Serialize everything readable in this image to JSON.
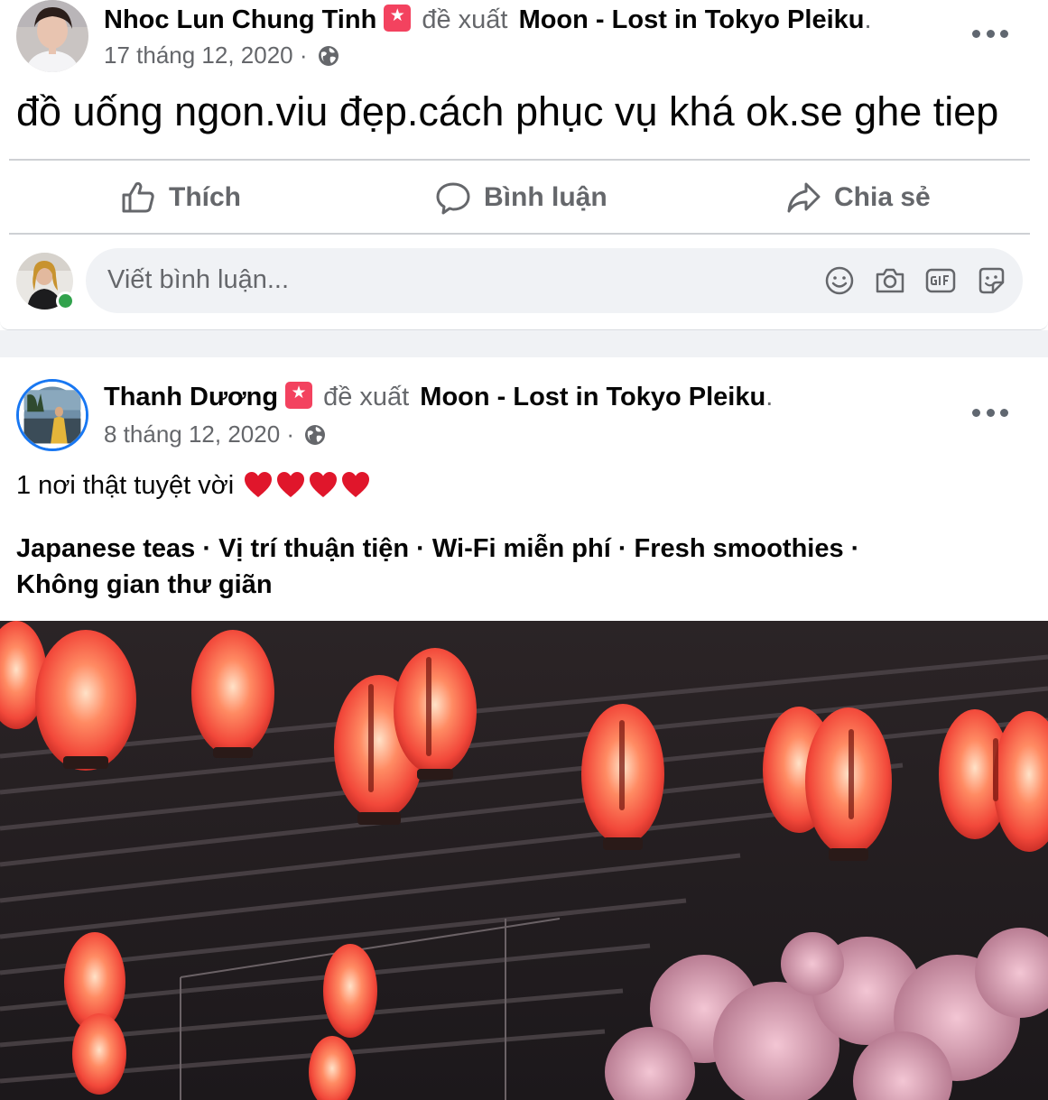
{
  "post1": {
    "author": "Nhoc Lun Chung Tinh",
    "recommends_label": "đề xuất",
    "page_name": "Moon - Lost in Tokyo Pleiku",
    "period": ".",
    "date": "17 tháng 12, 2020",
    "meta_separator": "·",
    "text": "đồ uống ngon.viu đẹp.cách phục vụ khá ok.se ghe tiep",
    "actions": {
      "like": "Thích",
      "comment": "Bình luận",
      "share": "Chia sẻ"
    },
    "comment_placeholder": "Viết bình luận..."
  },
  "post2": {
    "author": "Thanh Dương",
    "recommends_label": "đề xuất",
    "page_name": "Moon - Lost in Tokyo Pleiku",
    "period": ".",
    "date": "8 tháng 12, 2020",
    "meta_separator": "·",
    "text": "1 nơi thật tuyệt vời",
    "heart_count": 4,
    "tags_line1": "Japanese teas · Vị trí thuận tiện · Wi-Fi miễn phí · Fresh smoothies ·",
    "tags_line2": "Không gian thư giãn"
  },
  "icons": {
    "recommend": "recommend-star-icon",
    "privacy": "globe-icon",
    "more": "more-options-icon",
    "like": "thumbs-up-icon",
    "comment": "comment-bubble-icon",
    "share": "share-arrow-icon",
    "emoji": "emoji-icon",
    "camera": "camera-icon",
    "gif": "gif-icon",
    "sticker": "sticker-icon",
    "heart": "red-heart-icon"
  },
  "colors": {
    "text_primary": "#050505",
    "text_secondary": "#65676b",
    "recommend_badge": "#f3425f",
    "online": "#31a24c",
    "divider": "#ced0d4",
    "feed_background": "#f0f2f5"
  }
}
